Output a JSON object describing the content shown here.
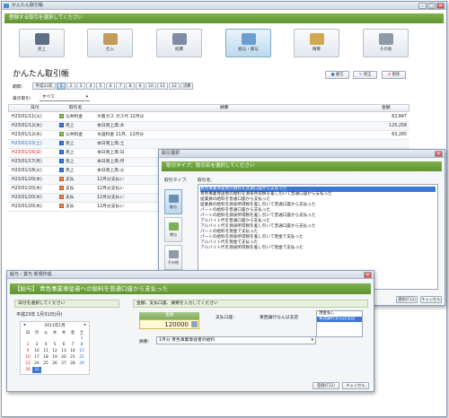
{
  "main": {
    "window_title": "かんたん取引帳",
    "prompt": "登録する取引を選択してください",
    "tabs": [
      {
        "label": "売上",
        "icon": "cash-register-icon"
      },
      {
        "label": "仕入",
        "icon": "box-icon"
      },
      {
        "label": "経費",
        "icon": "receipt-icon"
      },
      {
        "label": "給与・賞与",
        "icon": "salary-icon"
      },
      {
        "label": "精算",
        "icon": "calculator-icon"
      },
      {
        "label": "その他",
        "icon": "other-icon"
      }
    ],
    "heading": "かんたん取引帳",
    "period_label": "期間:",
    "year_button": "平成23年",
    "months": [
      "1",
      "2",
      "3",
      "4",
      "5",
      "6",
      "7",
      "8",
      "9",
      "10",
      "11",
      "12",
      "決算"
    ],
    "selected_month": "1",
    "actions": {
      "copy": "複写",
      "edit": "修正",
      "delete": "削除"
    },
    "filter_label": "表示取引:",
    "filter_value": "すべて",
    "columns": {
      "date": "日付",
      "category": "取引名",
      "summary": "摘要",
      "amount": "金額"
    },
    "rows": [
      {
        "date": "H23/01/11(火)",
        "category": "公共料金",
        "cat_color": "#8bc34a",
        "summary": "大阪ガス ガス代 12月分",
        "amount": "62,847",
        "date_color": "#222"
      },
      {
        "date": "H23/01/12(水)",
        "category": "売上",
        "cat_color": "#3a7bd5",
        "summary": "本日売上高:水",
        "amount": "125,258",
        "date_color": "#222"
      },
      {
        "date": "H23/01/12(水)",
        "category": "公共料金",
        "cat_color": "#8bc34a",
        "summary": "水道料金 11月、12月分",
        "amount": "63,265",
        "date_color": "#222"
      },
      {
        "date": "H23/01/15(土)",
        "category": "売上",
        "cat_color": "#3a7bd5",
        "summary": "本日売上高:土",
        "amount": "",
        "date_color": "#2a62c9"
      },
      {
        "date": "H23/01/16(日)",
        "category": "売上",
        "cat_color": "#3a7bd5",
        "summary": "本日売上高:日",
        "amount": "",
        "date_color": "#d22"
      },
      {
        "date": "H23/01/17(月)",
        "category": "売上",
        "cat_color": "#3a7bd5",
        "summary": "本日売上高:月",
        "amount": "",
        "date_color": "#222"
      },
      {
        "date": "H23/01/18(火)",
        "category": "売上",
        "cat_color": "#3a7bd5",
        "summary": "本日売上高:火",
        "amount": "",
        "date_color": "#222"
      },
      {
        "date": "H23/01/20(木)",
        "category": "支払",
        "cat_color": "#e8834a",
        "summary": "12月分支払い",
        "amount": "",
        "date_color": "#222"
      },
      {
        "date": "H23/01/20(木)",
        "category": "支払",
        "cat_color": "#e8834a",
        "summary": "12月分支払い",
        "amount": "",
        "date_color": "#222"
      },
      {
        "date": "H23/01/20(木)",
        "category": "支払",
        "cat_color": "#e8834a",
        "summary": "12月分支払い",
        "amount": "",
        "date_color": "#222"
      },
      {
        "date": "H23/01/20(木)",
        "category": "支払",
        "cat_color": "#e8834a",
        "summary": "12月分支払い",
        "amount": "",
        "date_color": "#222"
      }
    ]
  },
  "select_dialog": {
    "title": "取引選択",
    "prompt": "取引タイプ、取引名を選択してください",
    "type_label": "取引タイプ:",
    "name_label": "取引名:",
    "side_buttons": [
      {
        "label": "給与",
        "icon": "salary-icon"
      },
      {
        "label": "賞与",
        "icon": "bonus-icon"
      },
      {
        "label": "その他",
        "icon": "other-icon"
      }
    ],
    "items": [
      "青色事業専従者の給料を普通口座から支払った",
      "青色事業専従者の給料を源泉所得税を差し引いて普通口座から支払った",
      "従業員の給料を普通口座から支払った",
      "従業員の給料を源泉所得税を差し引いて普通口座から支払った",
      "パートの給料を普通口座から支払った",
      "パートの給料を源泉所得税を差し引いて普通口座から支払った",
      "アルバイト代を普通口座から支払った",
      "アルバイト代を源泉所得税を差し引いて普通口座から支払った",
      "パートの給料を現金で支払った",
      "パートの給料を源泉所得税を差し引いて現金で支払った",
      "アルバイト代を現金で支払った",
      "アルバイト代を源泉所得税を差し引いて現金で支払った"
    ],
    "selected_index": 0,
    "ok": "選択(F12)",
    "cancel": "キャンセル"
  },
  "entry_dialog": {
    "title": "給与・賞与 新規作成",
    "heading": "【給与】 青色事業専従者への給料を普通口座から支払った",
    "date_prompt": "日付を選択してください",
    "date_value": "平成23年 1月31日(月)",
    "calendar": {
      "month": "2011年1月",
      "weekdays": [
        "日",
        "月",
        "火",
        "水",
        "木",
        "金",
        "土"
      ],
      "weeks": [
        [
          "",
          "",
          "",
          "",
          "",
          "",
          "1"
        ],
        [
          "2",
          "3",
          "4",
          "5",
          "6",
          "7",
          "8"
        ],
        [
          "9",
          "10",
          "11",
          "12",
          "13",
          "14",
          "15"
        ],
        [
          "16",
          "17",
          "18",
          "19",
          "20",
          "21",
          "22"
        ],
        [
          "23",
          "24",
          "25",
          "26",
          "27",
          "28",
          "29"
        ],
        [
          "30",
          "31",
          "",
          "",
          "",
          "",
          ""
        ]
      ],
      "selected": "31"
    },
    "amount_prompt": "金額、支払口座、摘要を入力してください",
    "amount_label": "金額",
    "amount_value": "120000",
    "account_label": "支払口座:",
    "account_value": "東西銀行なんば支店",
    "account_options": [
      "現金払し",
      "東西銀行なんば支店"
    ],
    "summary_label": "摘要:",
    "summary_value": "1月分 青色事業専従者の給料",
    "ok": "登録(F12)",
    "cancel": "キャンセル"
  }
}
